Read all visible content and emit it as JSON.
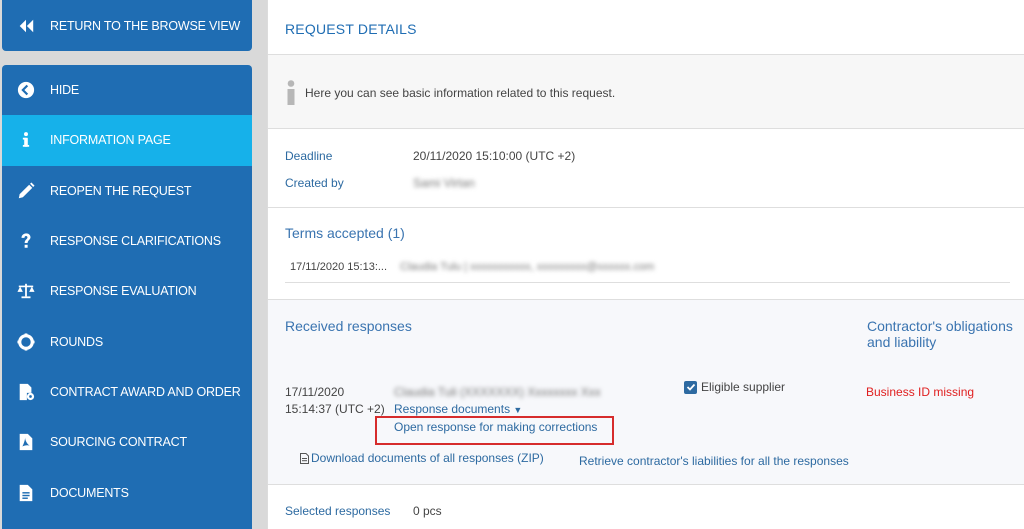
{
  "sidebar": {
    "return_label": "RETURN TO THE BROWSE VIEW",
    "items": [
      {
        "label": "HIDE",
        "icon": "chevron-left-circle-icon"
      },
      {
        "label": "INFORMATION PAGE",
        "icon": "info-icon"
      },
      {
        "label": "REOPEN THE REQUEST",
        "icon": "pencil-icon"
      },
      {
        "label": "RESPONSE CLARIFICATIONS",
        "icon": "question-icon"
      },
      {
        "label": "RESPONSE EVALUATION",
        "icon": "scale-icon"
      },
      {
        "label": "ROUNDS",
        "icon": "life-ring-icon"
      },
      {
        "label": "CONTRACT AWARD AND ORDER",
        "icon": "document-gear-icon"
      },
      {
        "label": "SOURCING CONTRACT",
        "icon": "pdf-document-icon"
      },
      {
        "label": "DOCUMENTS",
        "icon": "document-icon"
      }
    ],
    "active_index": 1
  },
  "main": {
    "title": "REQUEST DETAILS",
    "info_text": "Here you can see basic information related to this request.",
    "deadline_label": "Deadline",
    "deadline_value": "20/11/2020 15:10:00 (UTC +2)",
    "created_by_label": "Created by",
    "created_by_value": "Sami Virtan",
    "terms": {
      "title": "Terms accepted (1)",
      "entry_date": "17/11/2020 15:13:...",
      "entry_person": "Claudia Tulu | xxxxxxxxxxx, xxxxxxxxx@xxxxxx.com"
    },
    "responses": {
      "title": "Received responses",
      "obligations_title": "Contractor's obligations and liability",
      "date": "17/11/2020",
      "time": "15:14:37 (UTC +2)",
      "company": "Claudia Tuli (XXXXXXX) Xxxxxxxx Xxx",
      "documents_link": "Response documents",
      "eligible_label": "Eligible supplier",
      "missing_text": "Business ID missing",
      "open_link": "Open response for making corrections",
      "download_link": "Download documents of all responses (ZIP)",
      "retrieve_link": "Retrieve contractor's liabilities for all the responses"
    },
    "selected": {
      "label": "Selected responses",
      "value": "0 pcs"
    }
  },
  "colors": {
    "sidebar": "#1f6db3",
    "active_item": "#16b1ea",
    "link": "#2d6aa1",
    "error": "#e02020",
    "highlight_border": "#d62c2c"
  }
}
